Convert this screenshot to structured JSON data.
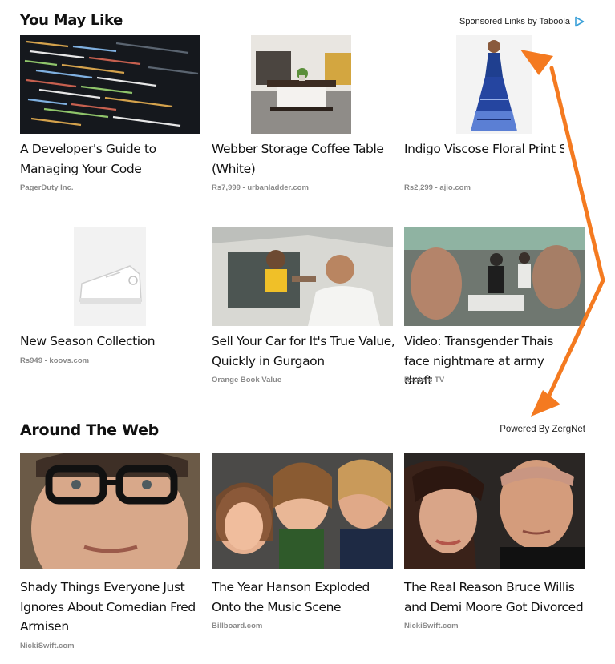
{
  "section1": {
    "title": "You May Like",
    "sponsor_text": "Sponsored Links by Taboola",
    "sponsor_icon": "taboola-play-icon",
    "cards": [
      {
        "title": "A Developer's Guide to Managing Your Code",
        "source": "PagerDuty Inc."
      },
      {
        "title": "Webber Storage Coffee Table (White)",
        "source": "Rs7,999 - urbanladder.com"
      },
      {
        "title": "Indigo Viscose Floral Print Sleeveless Maxi Dress by Bib",
        "source": "Rs2,299 - ajio.com"
      },
      {
        "title": "New Season Collection",
        "source": "Rs949 - koovs.com"
      },
      {
        "title": "Sell Your Car for It's True Value, Quickly in Gurgaon",
        "source": "Orange Book Value"
      },
      {
        "title": "Video: Transgender Thais face nightmare at army draft",
        "source": "Reuters TV"
      }
    ]
  },
  "section2": {
    "title": "Around The Web",
    "powered_text": "Powered By ZergNet",
    "cards": [
      {
        "title": "Shady Things Everyone Just Ignores About Comedian Fred Armisen",
        "source": "NickiSwift.com"
      },
      {
        "title": "The Year Hanson Exploded Onto the Music Scene",
        "source": "Billboard.com"
      },
      {
        "title": "The Real Reason Bruce Willis and Demi Moore Got Divorced",
        "source": "NickiSwift.com"
      }
    ]
  },
  "colors": {
    "arrow": "#f47a20",
    "taboola": "#3aa0d8",
    "source": "#8a8a8a"
  }
}
